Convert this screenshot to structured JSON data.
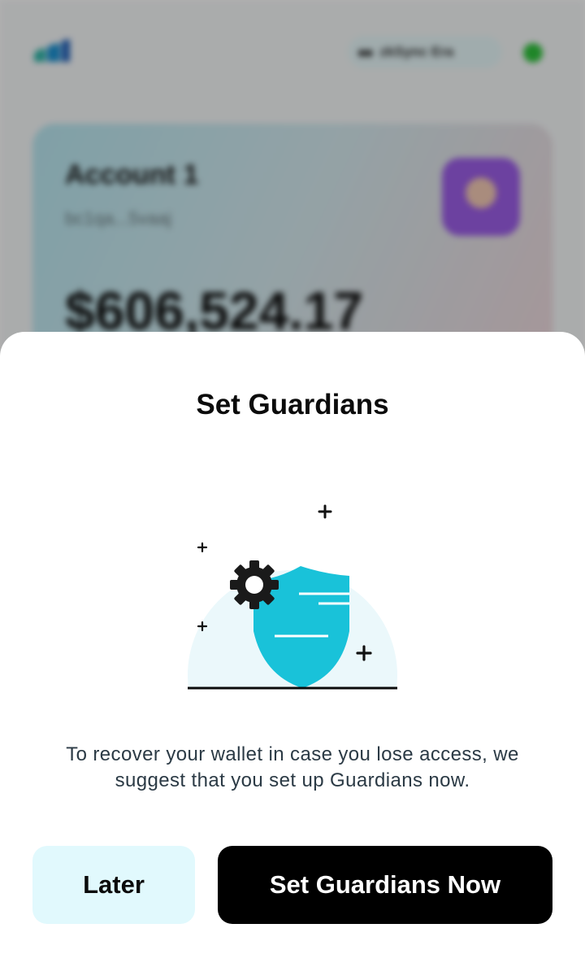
{
  "background": {
    "network_label": "zkSync Era",
    "account": {
      "name": "Account 1",
      "address": "bc1qa...5vaaj",
      "balance": "$606,524.17"
    },
    "colors": {
      "status_dot": "#2ec13b",
      "card_gradient_start": "#b7e6f0",
      "card_gradient_end": "#f1d6da"
    }
  },
  "modal": {
    "title": "Set Guardians",
    "illustration": {
      "icons": [
        "shield-icon",
        "gear-icon",
        "sparkle-plus-icon"
      ],
      "colors": {
        "shield": "#19c2d9",
        "circle": "#ebf8fb",
        "gear": "#1a1a1a"
      }
    },
    "message": "To recover your wallet in case you lose access, we suggest that you set up Guardians now.",
    "buttons": {
      "later_label": "Later",
      "primary_label": "Set Guardians Now"
    },
    "colors": {
      "later_bg": "#e1f9fd",
      "primary_bg": "#000000"
    }
  }
}
